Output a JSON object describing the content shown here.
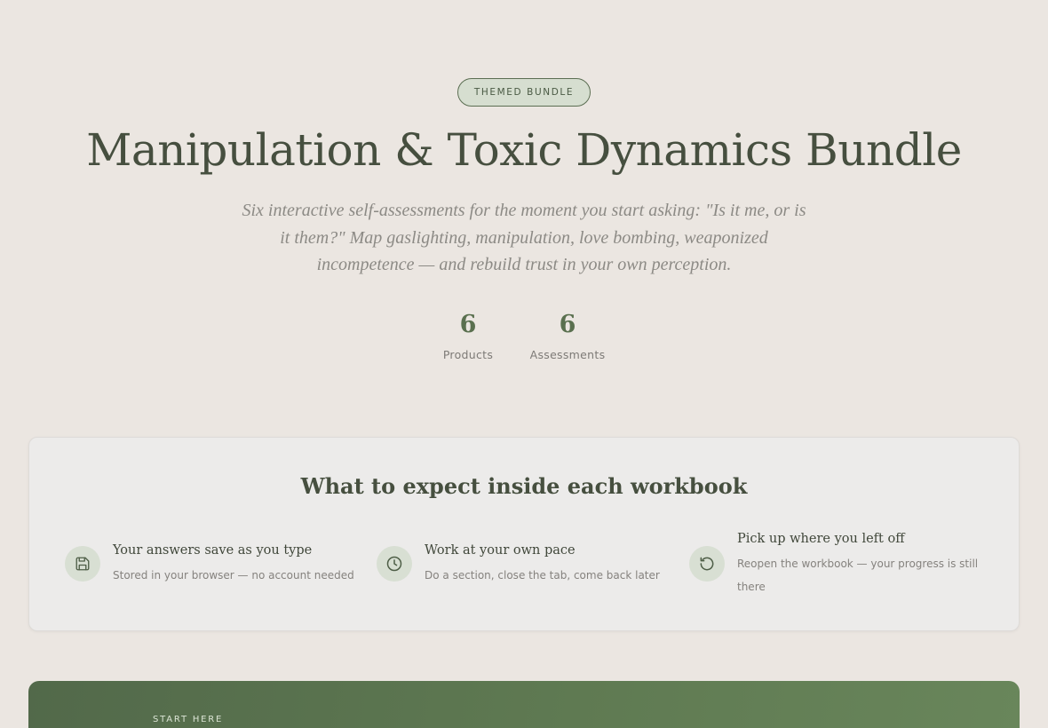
{
  "hero": {
    "badge": "THEMED BUNDLE",
    "title": "Manipulation & Toxic Dynamics Bundle",
    "subtitle": "Six interactive self-assessments for the moment you start asking: \"Is it me, or is it them?\" Map gaslighting, manipulation, love bombing, weaponized incompetence — and rebuild trust in your own perception.",
    "stats": [
      {
        "value": "6",
        "label": "Products"
      },
      {
        "value": "6",
        "label": "Assessments"
      }
    ]
  },
  "expect": {
    "title": "What to expect inside each workbook",
    "features": [
      {
        "icon": "save-icon",
        "title": "Your answers save as you type",
        "desc": "Stored in your browser — no account needed"
      },
      {
        "icon": "clock-icon",
        "title": "Work at your own pace",
        "desc": "Do a section, close the tab, come back later"
      },
      {
        "icon": "restore-icon",
        "title": "Pick up where you left off",
        "desc": "Reopen the workbook — your progress is still there"
      }
    ]
  },
  "cta": {
    "eyebrow": "START HERE"
  },
  "colors": {
    "background": "#ebe6e1",
    "accent_green": "#5a704f",
    "badge_bg": "#d6ded0",
    "cta_gradient_start": "#52694a",
    "cta_gradient_end": "#69865b"
  }
}
